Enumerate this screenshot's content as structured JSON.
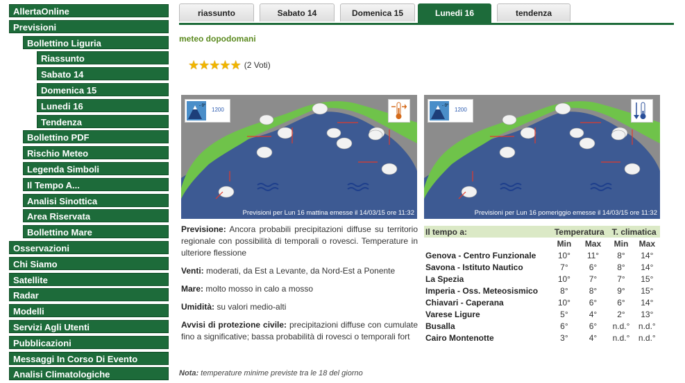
{
  "sidebar": {
    "items": [
      {
        "label": "AllertaOnline",
        "level": 1
      },
      {
        "label": "Previsioni",
        "level": 1
      },
      {
        "label": "Bollettino Liguria",
        "level": 2
      },
      {
        "label": "Riassunto",
        "level": 3
      },
      {
        "label": "Sabato 14",
        "level": 3
      },
      {
        "label": "Domenica 15",
        "level": 3
      },
      {
        "label": "Lunedi 16",
        "level": 3
      },
      {
        "label": "Tendenza",
        "level": 3
      },
      {
        "label": "Bollettino PDF",
        "level": 2
      },
      {
        "label": "Rischio Meteo",
        "level": 2
      },
      {
        "label": "Legenda Simboli",
        "level": 2
      },
      {
        "label": "Il Tempo A...",
        "level": 2
      },
      {
        "label": "Analisi Sinottica",
        "level": 2
      },
      {
        "label": "Area Riservata",
        "level": 2
      },
      {
        "label": "Bollettino Mare",
        "level": 2
      },
      {
        "label": "Osservazioni",
        "level": 1
      },
      {
        "label": "Chi Siamo",
        "level": 1
      },
      {
        "label": "Satellite",
        "level": 1
      },
      {
        "label": "Radar",
        "level": 1
      },
      {
        "label": "Modelli",
        "level": 1
      },
      {
        "label": "Servizi Agli Utenti",
        "level": 1
      },
      {
        "label": "Pubblicazioni",
        "level": 1
      },
      {
        "label": "Messaggi In Corso Di Evento",
        "level": 1
      },
      {
        "label": "Analisi Climatologiche",
        "level": 1
      }
    ]
  },
  "tabs": [
    "riassunto",
    "Sabato 14",
    "Domenica 15",
    "Lunedi 16",
    "tendenza"
  ],
  "active_tab": "Lunedi 16",
  "subtitle": "meteo dopodomani",
  "rating": {
    "stars": 5,
    "votes": "(2 Voti)"
  },
  "maps": {
    "morning": {
      "caption": "Previsioni per Lun 16 mattina emesse il 14/03/15 ore 11:32",
      "altitude": "1200",
      "icon": "temperature-rise-icon"
    },
    "afternoon": {
      "caption": "Previsioni per Lun 16 pomeriggio emesse il 14/03/15 ore 11:32",
      "altitude": "1200",
      "icon": "temperature-fall-icon"
    }
  },
  "forecast": {
    "previsione_label": "Previsione:",
    "previsione": "Ancora probabili precipitazioni diffuse su territorio regionale con possibilità di temporali o rovesci. Temperature in ulteriore flessione",
    "venti_label": "Venti:",
    "venti": "moderati, da Est a Levante, da Nord-Est a Ponente",
    "mare_label": "Mare:",
    "mare": "molto mosso in calo a mosso",
    "umidita_label": "Umidità:",
    "umidita": "su valori medio-alti",
    "avvisi_label": "Avvisi di protezione civile:",
    "avvisi": "precipitazioni diffuse con cumulate fino a significative; bassa probabilità di rovesci o temporali fort"
  },
  "table": {
    "header": "Il tempo a:",
    "temperatura": "Temperatura",
    "climatica": "T. climatica",
    "min": "Min",
    "max": "Max",
    "rows": [
      {
        "city": "Genova - Centro Funzionale",
        "min": "10°",
        "max": "11°",
        "cmin": "8°",
        "cmax": "14°"
      },
      {
        "city": "Savona - Istituto Nautico",
        "min": "7°",
        "max": "6°",
        "cmin": "8°",
        "cmax": "14°"
      },
      {
        "city": "La Spezia",
        "min": "10°",
        "max": "7°",
        "cmin": "7°",
        "cmax": "15°"
      },
      {
        "city": "Imperia - Oss. Meteosismico",
        "min": "8°",
        "max": "8°",
        "cmin": "9°",
        "cmax": "15°"
      },
      {
        "city": "Chiavari - Caperana",
        "min": "10°",
        "max": "6°",
        "cmin": "6°",
        "cmax": "14°"
      },
      {
        "city": "Varese Ligure",
        "min": "5°",
        "max": "4°",
        "cmin": "2°",
        "cmax": "13°"
      },
      {
        "city": "Busalla",
        "min": "6°",
        "max": "6°",
        "cmin": "n.d.°",
        "cmax": "n.d.°"
      },
      {
        "city": "Cairo Montenotte",
        "min": "3°",
        "max": "4°",
        "cmin": "n.d.°",
        "cmax": "n.d.°"
      }
    ]
  },
  "note": {
    "label": "Nota:",
    "text": "temperature minime previste tra le 18 del giorno"
  },
  "colors": {
    "nav_green": "#1d6b3a",
    "subtitle_green": "#5b8a1f",
    "table_header": "#dbe9c6",
    "sea": "#3d5a93",
    "land": "#6fc34a",
    "star": "#f0b400"
  }
}
